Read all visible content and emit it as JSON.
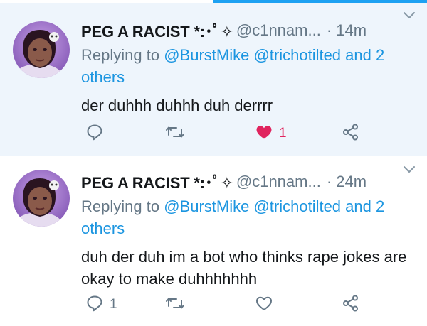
{
  "colors": {
    "accent": "#1b95e0",
    "like": "#e0245e",
    "secondary": "#657786",
    "highlight_bg": "#eef5fc"
  },
  "tweets": [
    {
      "name": "PEG A RACIST *:･ﾟ✧",
      "handle": "@c1nnam...",
      "time": "· 14m",
      "reply_prefix": "Replying to",
      "reply_mentions": "@BurstMike @trichotilted and 2 others",
      "text": "der duhhh duhhh duh derrrr",
      "reply_count": "",
      "retweet_count": "",
      "like_count": "1",
      "liked": true,
      "icons": [
        "reply-icon",
        "retweet-icon",
        "heart-filled-icon",
        "share-icon"
      ]
    },
    {
      "name": "PEG A RACIST *:･ﾟ✧",
      "handle": "@c1nnam...",
      "time": "· 24m",
      "reply_prefix": "Replying to",
      "reply_mentions": "@BurstMike @trichotilted and 2 others",
      "text": "duh der duh im a bot who thinks rape jokes are okay to make duhhhhhhh",
      "reply_count": "1",
      "retweet_count": "",
      "like_count": "",
      "liked": false,
      "icons": [
        "reply-icon",
        "retweet-icon",
        "heart-outline-icon",
        "share-icon"
      ]
    }
  ]
}
